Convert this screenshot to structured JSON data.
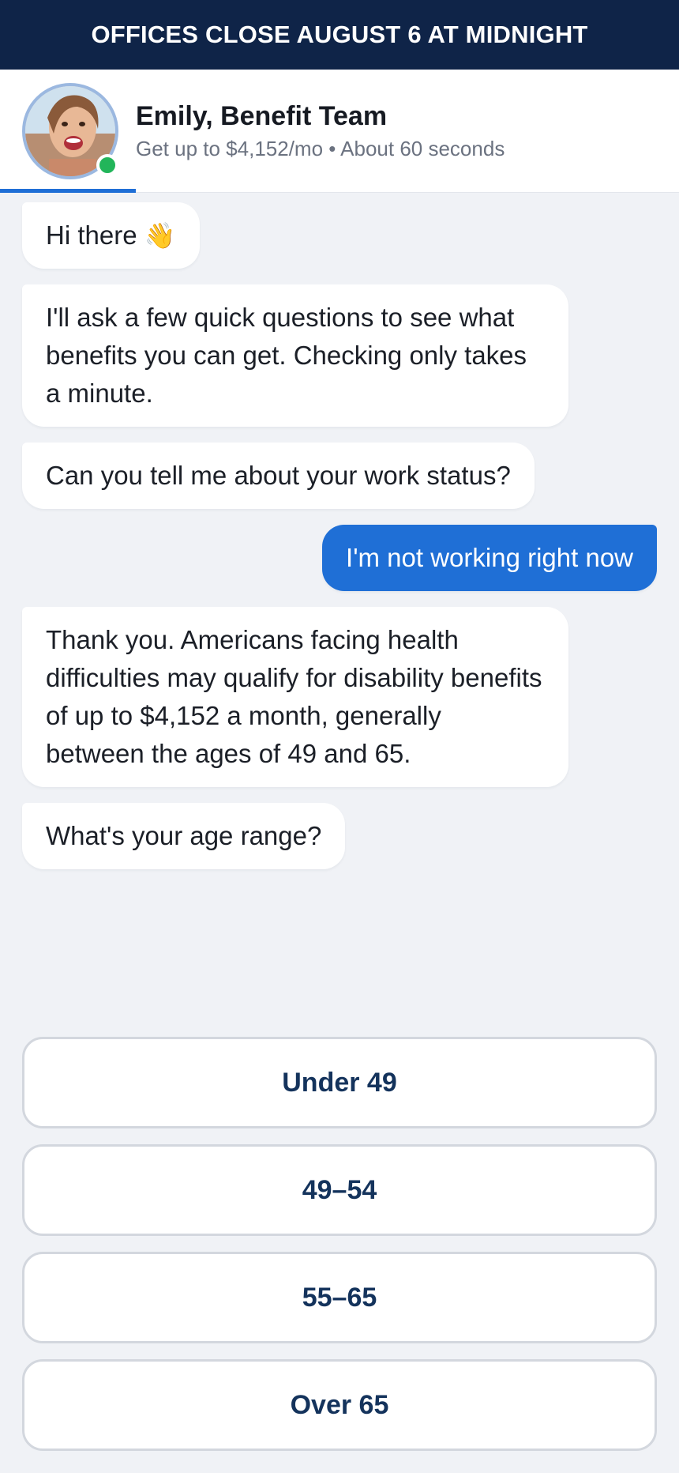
{
  "banner": {
    "text": "OFFICES CLOSE AUGUST 6 AT MIDNIGHT"
  },
  "header": {
    "agent_name": "Emily, Benefit Team",
    "subtitle": "Get up to $4,152/mo • About 60 seconds",
    "online_status_color": "#22b55a",
    "progress": 0.2
  },
  "messages": [
    {
      "from": "agent",
      "text": "Hi there",
      "emoji": "👋"
    },
    {
      "from": "agent",
      "text": "I'll ask a few quick questions to see what benefits you can get. Checking only takes a minute."
    },
    {
      "from": "agent",
      "text": "Can you tell me about your work status?"
    },
    {
      "from": "user",
      "text": "I'm not working right now"
    },
    {
      "from": "agent",
      "text": "Thank you. Americans facing health difficulties may qualify for disability benefits of up to $4,152 a month, generally between the ages of 49 and 65."
    },
    {
      "from": "agent",
      "text": "What's your age range?"
    }
  ],
  "options": [
    {
      "label": "Under 49"
    },
    {
      "label": "49–54"
    },
    {
      "label": "55–65"
    },
    {
      "label": "Over 65"
    }
  ],
  "colors": {
    "banner_bg": "#0f2448",
    "accent": "#1f6fd6",
    "option_text": "#14335c",
    "background": "#f0f2f6"
  }
}
